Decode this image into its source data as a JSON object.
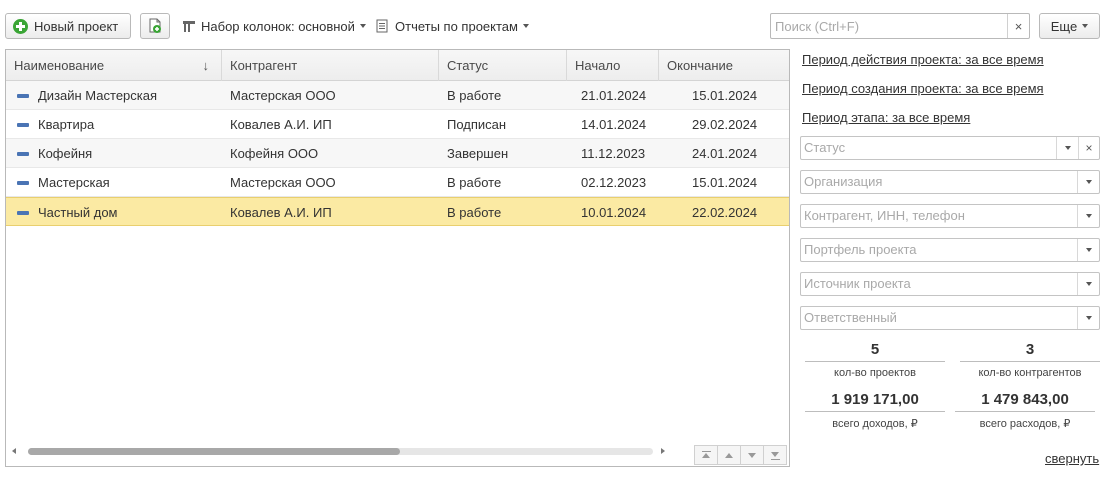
{
  "toolbar": {
    "new_project_label": "Новый проект",
    "column_set_label": "Набор колонок: основной",
    "reports_label": "Отчеты по проектам",
    "search_placeholder": "Поиск (Ctrl+F)",
    "more_label": "Еще"
  },
  "grid": {
    "columns": [
      "Наименование",
      "Контрагент",
      "Статус",
      "Начало",
      "Окончание"
    ],
    "rows": [
      {
        "name": "Дизайн Мастерская",
        "contractor": "Мастерская ООО",
        "status": "В работе",
        "start": "21.01.2024",
        "end": "15.01.2024"
      },
      {
        "name": "Квартира",
        "contractor": "Ковалев А.И. ИП",
        "status": "Подписан",
        "start": "14.01.2024",
        "end": "29.02.2024"
      },
      {
        "name": "Кофейня",
        "contractor": "Кофейня ООО",
        "status": "Завершен",
        "start": "11.12.2023",
        "end": "24.01.2024"
      },
      {
        "name": "Мастерская",
        "contractor": "Мастерская ООО",
        "status": "В работе",
        "start": "02.12.2023",
        "end": "15.01.2024"
      },
      {
        "name": "Частный дом",
        "contractor": "Ковалев А.И. ИП",
        "status": "В работе",
        "start": "10.01.2024",
        "end": "22.02.2024"
      }
    ],
    "selected_row": 4
  },
  "filters": {
    "period_action": "Период действия проекта: за все время",
    "period_created": "Период создания проекта: за все время",
    "period_stage": "Период этапа: за все время",
    "status_placeholder": "Статус",
    "organization_placeholder": "Организация",
    "contractor_placeholder": "Контрагент, ИНН, телефон",
    "portfolio_placeholder": "Портфель проекта",
    "source_placeholder": "Источник проекта",
    "responsible_placeholder": "Ответственный"
  },
  "stats": {
    "projects_count": "5",
    "projects_label": "кол-во проектов",
    "contractors_count": "3",
    "contractors_label": "кол-во контрагентов",
    "income_total": "1 919 171,00",
    "income_label": "всего доходов, ₽",
    "expense_total": "1 479 843,00",
    "expense_label": "всего расходов, ₽"
  },
  "collapse_label": "свернуть",
  "colors": {
    "accent_green": "#3aa535",
    "selected_row": "#fbeaa3",
    "row_marker": "#4a74b4"
  }
}
